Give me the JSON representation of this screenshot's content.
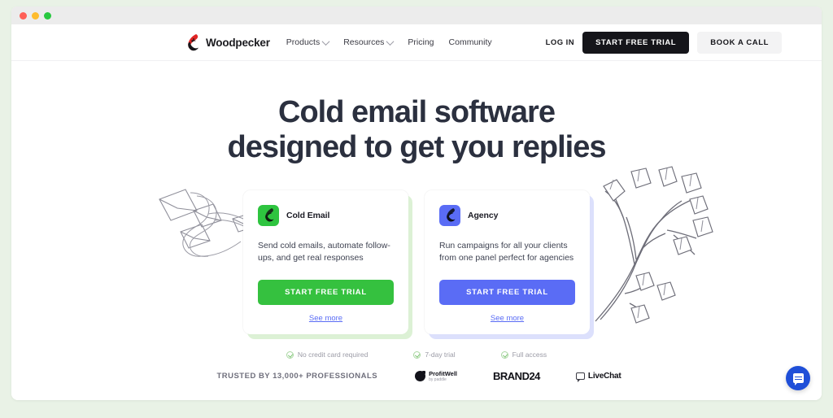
{
  "browser": {
    "traffic_lights": [
      "close",
      "minimize",
      "zoom"
    ]
  },
  "nav": {
    "brand": "Woodpecker",
    "links": [
      {
        "label": "Products",
        "has_dropdown": true
      },
      {
        "label": "Resources",
        "has_dropdown": true
      },
      {
        "label": "Pricing",
        "has_dropdown": false
      },
      {
        "label": "Community",
        "has_dropdown": false
      }
    ],
    "login_label": "LOG IN",
    "primary_cta": "START FREE TRIAL",
    "secondary_cta": "BOOK A CALL"
  },
  "hero": {
    "headline_line1": "Cold email software",
    "headline_line2": "designed to get you replies",
    "decorations": [
      "flying-envelopes-illustration",
      "tree-branch-illustration"
    ]
  },
  "cards": [
    {
      "icon_name": "woodpecker-bird-icon",
      "accent": "#2ec43f",
      "title": "Cold Email",
      "description": "Send cold emails, automate follow-ups, and get real responses",
      "cta": "START FREE TRIAL",
      "link": "See more"
    },
    {
      "icon_name": "woodpecker-bird-icon",
      "accent": "#5a6cf5",
      "title": "Agency",
      "description": "Run campaigns for all your clients from one panel perfect for agencies",
      "cta": "START FREE TRIAL",
      "link": "See more"
    }
  ],
  "perks": [
    "No credit card required",
    "7-day trial",
    "Full access"
  ],
  "trusted": {
    "label": "TRUSTED BY 13,000+ PROFESSIONALS",
    "logos": [
      {
        "name": "ProfitWell",
        "sub": "by paddle"
      },
      {
        "name": "BRAND24"
      },
      {
        "name": "LiveChat"
      }
    ]
  },
  "chat": {
    "widget_name": "messenger-launcher",
    "color": "#1f4fd8"
  },
  "colors": {
    "page_background": "#e9f2e6",
    "chrome_bar": "#ececec",
    "headline": "#2b303f",
    "green_accent": "#35c13f",
    "blue_accent": "#5a6cf5",
    "dark_button": "#15151a"
  }
}
